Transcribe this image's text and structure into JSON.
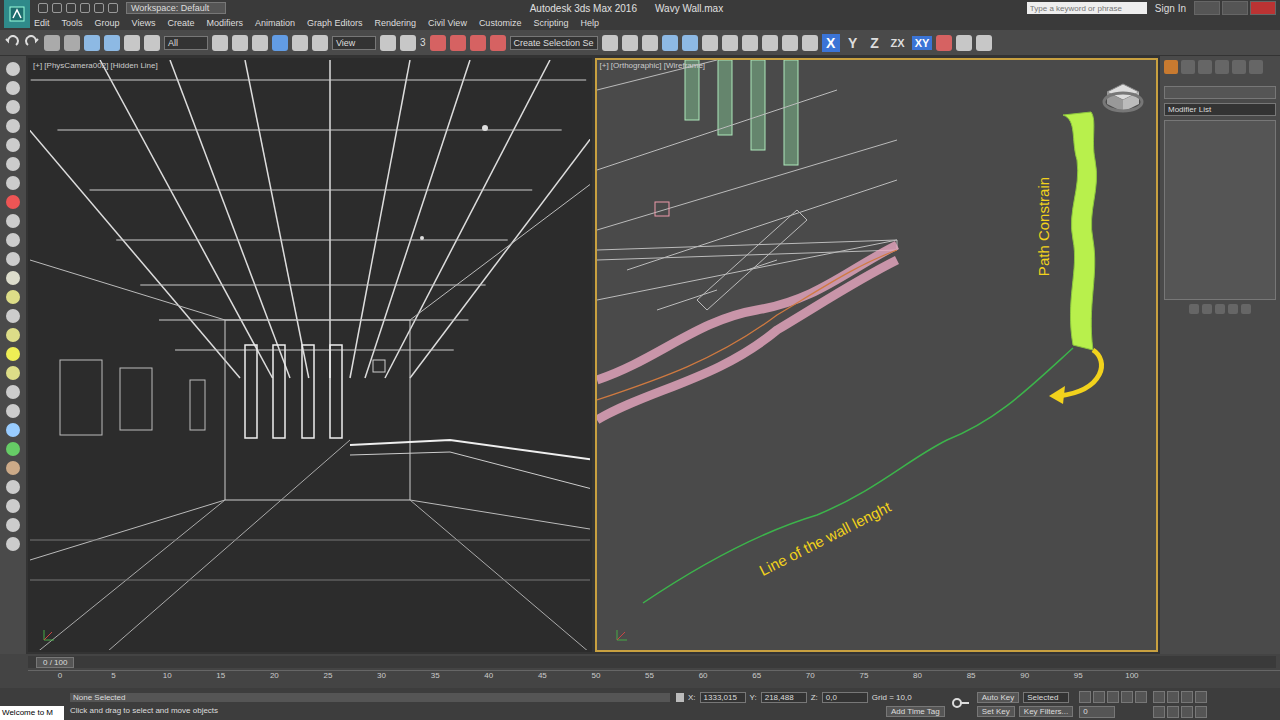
{
  "window": {
    "title": "Autodesk 3ds Max 2016",
    "file": "Wavy Wall.max",
    "workspace": "Workspace: Default"
  },
  "search": {
    "placeholder": "Type a keyword or phrase"
  },
  "sign_in": "Sign In",
  "menu": [
    "Edit",
    "Tools",
    "Group",
    "Views",
    "Create",
    "Modifiers",
    "Animation",
    "Graph Editors",
    "Rendering",
    "Civil View",
    "Customize",
    "Scripting",
    "Help"
  ],
  "toolbar": {
    "selection_filter": "All",
    "reference_coord": "View",
    "snap": "3",
    "named_selection": "Create Selection Se",
    "axes": [
      {
        "label": "X",
        "selected": true
      },
      {
        "label": "Y",
        "selected": false
      },
      {
        "label": "Z",
        "selected": false
      },
      {
        "label": "ZX",
        "selected": false
      },
      {
        "label": "XY",
        "selected": true
      }
    ]
  },
  "viewports": [
    {
      "label": "[+] [PhysCamera002] [Hidden Line]",
      "selected": false
    },
    {
      "label": "[+] [Orthographic] [Wireframe]",
      "selected": true
    }
  ],
  "annotations": {
    "path": "Path Constrain",
    "line": "Line of the wall lenght"
  },
  "command_panel": {
    "modifier_list": "Modifier List"
  },
  "timeline": {
    "frame": "0 / 100",
    "level": 0,
    "ticks": [
      "0",
      "5",
      "10",
      "15",
      "20",
      "25",
      "30",
      "35",
      "40",
      "45",
      "50",
      "55",
      "60",
      "65",
      "70",
      "75",
      "80",
      "85",
      "90",
      "95",
      "100"
    ]
  },
  "status": {
    "welcome": "Welcome to M",
    "selection": "None Selected",
    "prompt": "Click and drag to select and move objects",
    "x_label": "X:",
    "x": "1333,015",
    "y_label": "Y:",
    "y": "218,488",
    "z_label": "Z:",
    "z": "0,0",
    "grid": "Grid = 10,0",
    "time_tag": "Add Time Tag",
    "auto_key": "Auto Key",
    "key_mode": "Selected",
    "set_key": "Set Key",
    "key_filters": "Key Filters...",
    "frame": "0"
  }
}
